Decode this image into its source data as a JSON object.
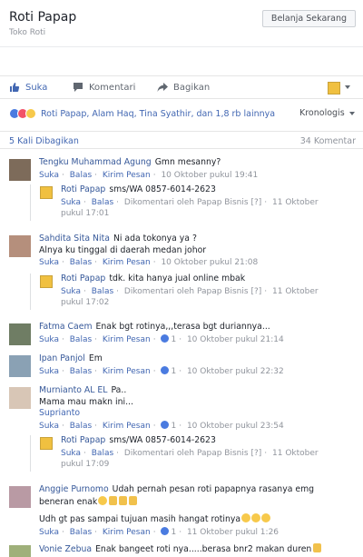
{
  "header": {
    "page_name": "Roti Papap",
    "category": "Toko Roti",
    "shop_button": "Belanja Sekarang"
  },
  "actions": {
    "like": "Suka",
    "comment": "Komentari",
    "share": "Bagikan"
  },
  "reactions": {
    "text": "Roti Papap, Alam Haq, Tina Syathir, dan 1,8 rb lainnya",
    "sort": "Kronologis"
  },
  "stats": {
    "shares": "5 Kali Dibagikan",
    "comments": "34 Komentar"
  },
  "colors": {
    "link": "#4267b2",
    "author": "#365899",
    "meta": "#90949c",
    "like_blue": "#4a7be0"
  },
  "c1": {
    "author": "Tengku Muhammad Agung",
    "text": "Gmn mesanny?",
    "like": "Suka",
    "reply": "Balas",
    "msg": "Kirim Pesan",
    "time": "10 Oktober pukul 19:41"
  },
  "r1": {
    "author": "Roti Papap",
    "text": "sms/WA 0857-6014-2623",
    "like": "Suka",
    "reply": "Balas",
    "by": "Dikomentari oleh Papap Bisnis",
    "q": "[?]",
    "date": "11 Oktober",
    "time": "pukul 17:01"
  },
  "c2": {
    "author": "Sahdita Sita Nita",
    "line1": "Ni ada tokonya ya ?",
    "line2": "Alnya ku tinggal di daerah medan johor",
    "like": "Suka",
    "reply": "Balas",
    "msg": "Kirim Pesan",
    "time": "10 Oktober pukul 21:08"
  },
  "r2": {
    "author": "Roti Papap",
    "text": "tdk. kita hanya jual online mbak",
    "like": "Suka",
    "reply": "Balas",
    "by": "Dikomentari oleh Papap Bisnis",
    "q": "[?]",
    "date": "11 Oktober",
    "time": "pukul 17:02"
  },
  "c3": {
    "author": "Fatma Caem",
    "text": "Enak bgt rotinya,,,terasa bgt duriannya...",
    "like": "Suka",
    "reply": "Balas",
    "msg": "Kirim Pesan",
    "likes": "1",
    "time": "10 Oktober pukul 21:14"
  },
  "c4": {
    "author": "Ipan Panjol",
    "text": "Em",
    "like": "Suka",
    "reply": "Balas",
    "msg": "Kirim Pesan",
    "likes": "1",
    "time": "10 Oktober pukul 22:32"
  },
  "c5": {
    "author": "Murnianto AL EL",
    "text": "Pa..",
    "line2": "Mama mau makn ini...",
    "tag": "Suprianto",
    "like": "Suka",
    "reply": "Balas",
    "msg": "Kirim Pesan",
    "likes": "1",
    "time": "10 Oktober pukul 23:54"
  },
  "r5": {
    "author": "Roti Papap",
    "text": "sms/WA 0857-6014-2623",
    "like": "Suka",
    "reply": "Balas",
    "by": "Dikomentari oleh Papap Bisnis",
    "q": "[?]",
    "date": "11 Oktober",
    "time": "pukul 17:09"
  },
  "c6": {
    "author": "Anggie Purnomo",
    "text": "Udah pernah pesan roti papapnya rasanya emg",
    "line2": "beneran enak",
    "line3": "Udh gt pas sampai tujuan masih hangat rotinya",
    "like": "Suka",
    "reply": "Balas",
    "msg": "Kirim Pesan",
    "likes": "1",
    "time": "11 Oktober pukul 1:26"
  },
  "c7": {
    "author": "Vonie Zebua",
    "text": "Enak bangeet roti nya.....berasa bnr2 makan duren"
  }
}
